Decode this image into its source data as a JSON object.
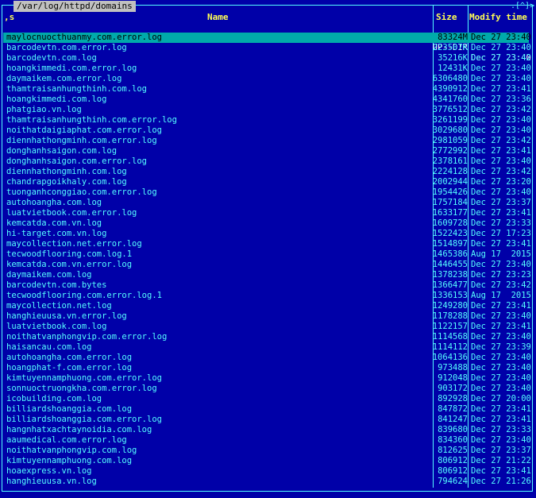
{
  "panel": {
    "path": "/var/log/httpd/domains",
    "corner": ".[^]>",
    "headers": {
      "sort": ",s",
      "name": "Name",
      "size": "Size",
      "modify": "Modify time"
    }
  },
  "up_row": {
    "name": "/..",
    "size": "UP--DIR",
    "time": "Dec 27 23:40"
  },
  "files": [
    {
      "name": "maylocnuocthuanmy.com.error.log",
      "size": "83324M",
      "time": "Dec 27 23:40"
    },
    {
      "name": "barcodevtn.com.error.log",
      "size": "223507K",
      "time": "Dec 27 23:40"
    },
    {
      "name": "barcodevtn.com.log",
      "size": "35216K",
      "time": "Dec 27 23:42"
    },
    {
      "name": "hoangkimmedi.com.error.log",
      "size": "12431K",
      "time": "Dec 27 23:40"
    },
    {
      "name": "daymaikem.com.error.log",
      "size": "6306480",
      "time": "Dec 27 23:40"
    },
    {
      "name": "thamtraisanhungthinh.com.log",
      "size": "4390912",
      "time": "Dec 27 23:41"
    },
    {
      "name": "hoangkimmedi.com.log",
      "size": "4341760",
      "time": "Dec 27 23:36"
    },
    {
      "name": "phatgiao.vn.log",
      "size": "3776512",
      "time": "Dec 27 23:42"
    },
    {
      "name": "thamtraisanhungthinh.com.error.log",
      "size": "3261199",
      "time": "Dec 27 23:40"
    },
    {
      "name": "noithatdaigiaphat.com.error.log",
      "size": "3029680",
      "time": "Dec 27 23:40"
    },
    {
      "name": "diennhathongminh.com.error.log",
      "size": "2981059",
      "time": "Dec 27 23:42"
    },
    {
      "name": "donghanhsaigon.com.log",
      "size": "2772992",
      "time": "Dec 27 23:41"
    },
    {
      "name": "donghanhsaigon.com.error.log",
      "size": "2378161",
      "time": "Dec 27 23:40"
    },
    {
      "name": "diennhathongminh.com.log",
      "size": "2224128",
      "time": "Dec 27 23:42"
    },
    {
      "name": "chandrapgoikhaly.com.log",
      "size": "2002944",
      "time": "Dec 27 23:20"
    },
    {
      "name": "tuonganhconggiao.com.error.log",
      "size": "1954426",
      "time": "Dec 27 23:40"
    },
    {
      "name": "autohoangha.com.log",
      "size": "1757184",
      "time": "Dec 27 23:37"
    },
    {
      "name": "luatvietbook.com.error.log",
      "size": "1633177",
      "time": "Dec 27 23:41"
    },
    {
      "name": "kemcatda.com.vn.log",
      "size": "1609728",
      "time": "Dec 27 23:33"
    },
    {
      "name": "hi-target.com.vn.log",
      "size": "1522423",
      "time": "Dec 27 17:23"
    },
    {
      "name": "maycollection.net.error.log",
      "size": "1514897",
      "time": "Dec 27 23:41"
    },
    {
      "name": "tecwoodflooring.com.log.1",
      "size": "1465386",
      "time": "Aug 17  2015"
    },
    {
      "name": "kemcatda.com.vn.error.log",
      "size": "1446455",
      "time": "Dec 27 23:40"
    },
    {
      "name": "daymaikem.com.log",
      "size": "1378238",
      "time": "Dec 27 23:23"
    },
    {
      "name": "barcodevtn.com.bytes",
      "size": "1366477",
      "time": "Dec 27 23:42"
    },
    {
      "name": "tecwoodflooring.com.error.log.1",
      "size": "1336153",
      "time": "Aug 17  2015"
    },
    {
      "name": "maycollection.net.log",
      "size": "1249280",
      "time": "Dec 27 23:41"
    },
    {
      "name": "hanghieuusa.vn.error.log",
      "size": "1178288",
      "time": "Dec 27 23:40"
    },
    {
      "name": "luatvietbook.com.log",
      "size": "1122157",
      "time": "Dec 27 23:41"
    },
    {
      "name": "noithatvanphongvip.com.error.log",
      "size": "1114568",
      "time": "Dec 27 23:40"
    },
    {
      "name": "haisancau.com.log",
      "size": "1114112",
      "time": "Dec 27 23:39"
    },
    {
      "name": "autohoangha.com.error.log",
      "size": "1064136",
      "time": "Dec 27 23:40"
    },
    {
      "name": "hoangphat-f.com.error.log",
      "size": "973488",
      "time": "Dec 27 23:40"
    },
    {
      "name": "kimtuyennamphuong.com.error.log",
      "size": "912048",
      "time": "Dec 27 23:40"
    },
    {
      "name": "sonnuoctruongkha.com.error.log",
      "size": "903172",
      "time": "Dec 27 23:40"
    },
    {
      "name": "icobuilding.com.log",
      "size": "892928",
      "time": "Dec 27 20:00"
    },
    {
      "name": "billiardshoanggia.com.log",
      "size": "847872",
      "time": "Dec 27 23:41"
    },
    {
      "name": "billiardshoanggia.com.error.log",
      "size": "841247",
      "time": "Dec 27 23:41"
    },
    {
      "name": "hangnhatxachtaynoidia.com.log",
      "size": "839680",
      "time": "Dec 27 23:33"
    },
    {
      "name": "aaumedical.com.error.log",
      "size": "834360",
      "time": "Dec 27 23:40"
    },
    {
      "name": "noithatvanphongvip.com.log",
      "size": "812625",
      "time": "Dec 27 23:37"
    },
    {
      "name": "kimtuyennamphuong.com.log",
      "size": "806912",
      "time": "Dec 27 21:22"
    },
    {
      "name": "hoaexpress.vn.log",
      "size": "806912",
      "time": "Dec 27 23:41"
    },
    {
      "name": "hanghieuusa.vn.log",
      "size": "794624",
      "time": "Dec 27 21:26"
    }
  ],
  "colors": {
    "background": "#0000a8",
    "text": "#55ffff",
    "header": "#ffff55",
    "selection": "#00aaaa",
    "title_bg": "#c0c0c0"
  }
}
